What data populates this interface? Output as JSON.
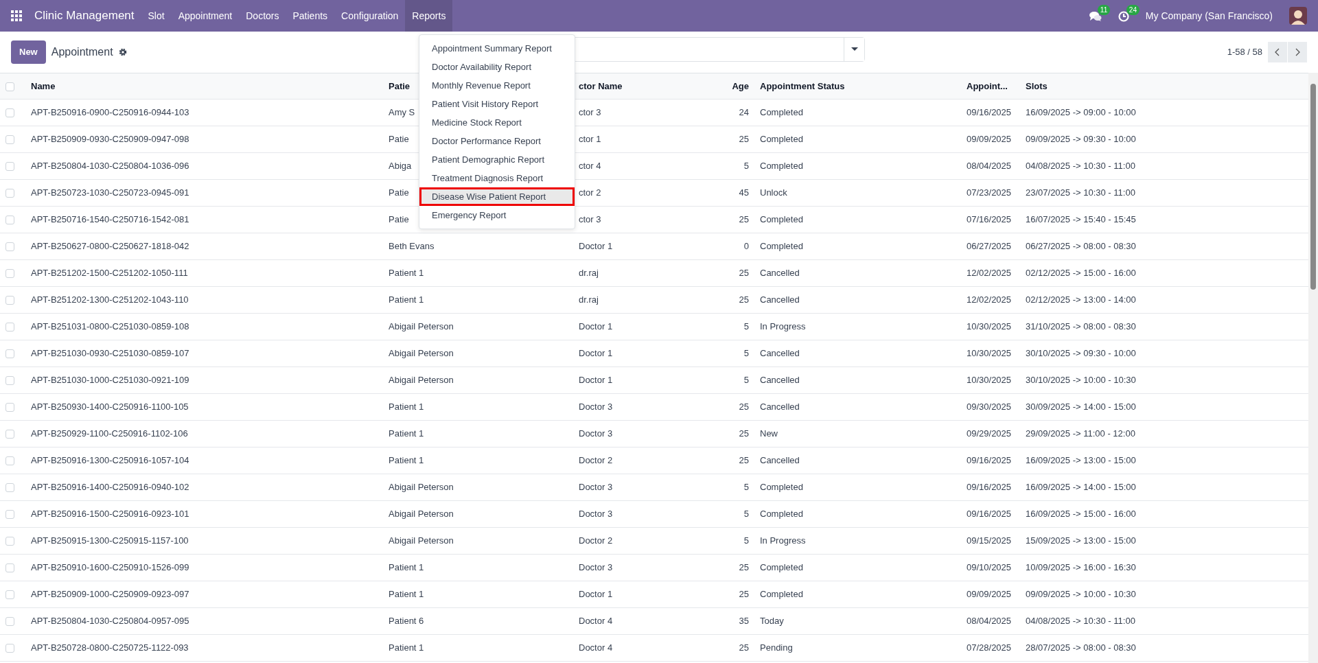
{
  "navbar": {
    "app_title": "Clinic Management",
    "menus": [
      {
        "label": "Slot",
        "open": false
      },
      {
        "label": "Appointment",
        "open": false
      },
      {
        "label": "Doctors",
        "open": false
      },
      {
        "label": "Patients",
        "open": false
      },
      {
        "label": "Configuration",
        "open": false
      },
      {
        "label": "Reports",
        "open": true
      }
    ],
    "messages_badge": "11",
    "activities_badge": "24",
    "company": "My Company (San Francisco)"
  },
  "control_panel": {
    "new_button": "New",
    "title": "Appointment",
    "pager": "1-58 / 58"
  },
  "reports_menu": {
    "items": [
      {
        "label": "Appointment Summary Report",
        "selected": false
      },
      {
        "label": "Doctor Availability Report",
        "selected": false
      },
      {
        "label": "Monthly Revenue Report",
        "selected": false
      },
      {
        "label": "Patient Visit History Report",
        "selected": false
      },
      {
        "label": "Medicine Stock Report",
        "selected": false
      },
      {
        "label": "Doctor Performance Report",
        "selected": false
      },
      {
        "label": "Patient Demographic Report",
        "selected": false
      },
      {
        "label": "Treatment Diagnosis Report",
        "selected": false
      },
      {
        "label": "Disease Wise Patient Report",
        "selected": true
      },
      {
        "label": "Emergency Report",
        "selected": false
      }
    ]
  },
  "table": {
    "select_all_checked": false,
    "columns": [
      "Name",
      "Patie",
      "ctor Name",
      "Age",
      "Appointment Status",
      "Appoint...",
      "Slots"
    ],
    "rows": [
      {
        "checked": false,
        "cells": [
          "APT-B250916-0900-C250916-0944-103",
          "Amy S",
          "ctor 3",
          "24",
          "Completed",
          "09/16/2025",
          "16/09/2025 -> 09:00 - 10:00"
        ]
      },
      {
        "checked": false,
        "cells": [
          "APT-B250909-0930-C250909-0947-098",
          "Patie",
          "ctor 1",
          "25",
          "Completed",
          "09/09/2025",
          "09/09/2025 -> 09:30 - 10:00"
        ]
      },
      {
        "checked": false,
        "cells": [
          "APT-B250804-1030-C250804-1036-096",
          "Abiga",
          "ctor 4",
          "5",
          "Completed",
          "08/04/2025",
          "04/08/2025 -> 10:30 - 11:00"
        ]
      },
      {
        "checked": false,
        "cells": [
          "APT-B250723-1030-C250723-0945-091",
          "Patie",
          "ctor 2",
          "45",
          "Unlock",
          "07/23/2025",
          "23/07/2025 -> 10:30 - 11:00"
        ]
      },
      {
        "checked": false,
        "cells": [
          "APT-B250716-1540-C250716-1542-081",
          "Patie",
          "ctor 3",
          "25",
          "Completed",
          "07/16/2025",
          "16/07/2025 -> 15:40 - 15:45"
        ]
      },
      {
        "checked": false,
        "cells": [
          "APT-B250627-0800-C250627-1818-042",
          "Beth Evans",
          "Doctor 1",
          "0",
          "Completed",
          "06/27/2025",
          "06/27/2025 -> 08:00 - 08:30"
        ]
      },
      {
        "checked": false,
        "cells": [
          "APT-B251202-1500-C251202-1050-111",
          "Patient 1",
          "dr.raj",
          "25",
          "Cancelled",
          "12/02/2025",
          "02/12/2025 -> 15:00 - 16:00"
        ]
      },
      {
        "checked": false,
        "cells": [
          "APT-B251202-1300-C251202-1043-110",
          "Patient 1",
          "dr.raj",
          "25",
          "Cancelled",
          "12/02/2025",
          "02/12/2025 -> 13:00 - 14:00"
        ]
      },
      {
        "checked": false,
        "cells": [
          "APT-B251031-0800-C251030-0859-108",
          "Abigail Peterson",
          "Doctor 1",
          "5",
          "In Progress",
          "10/30/2025",
          "31/10/2025 -> 08:00 - 08:30"
        ]
      },
      {
        "checked": false,
        "cells": [
          "APT-B251030-0930-C251030-0859-107",
          "Abigail Peterson",
          "Doctor 1",
          "5",
          "Cancelled",
          "10/30/2025",
          "30/10/2025 -> 09:30 - 10:00"
        ]
      },
      {
        "checked": false,
        "cells": [
          "APT-B251030-1000-C251030-0921-109",
          "Abigail Peterson",
          "Doctor 1",
          "5",
          "Cancelled",
          "10/30/2025",
          "30/10/2025 -> 10:00 - 10:30"
        ]
      },
      {
        "checked": false,
        "cells": [
          "APT-B250930-1400-C250916-1100-105",
          "Patient 1",
          "Doctor 3",
          "25",
          "Cancelled",
          "09/30/2025",
          "30/09/2025 -> 14:00 - 15:00"
        ]
      },
      {
        "checked": false,
        "cells": [
          "APT-B250929-1100-C250916-1102-106",
          "Patient 1",
          "Doctor 3",
          "25",
          "New",
          "09/29/2025",
          "29/09/2025 -> 11:00 - 12:00"
        ]
      },
      {
        "checked": false,
        "cells": [
          "APT-B250916-1300-C250916-1057-104",
          "Patient 1",
          "Doctor 2",
          "25",
          "Cancelled",
          "09/16/2025",
          "16/09/2025 -> 13:00 - 15:00"
        ]
      },
      {
        "checked": false,
        "cells": [
          "APT-B250916-1400-C250916-0940-102",
          "Abigail Peterson",
          "Doctor 3",
          "5",
          "Completed",
          "09/16/2025",
          "16/09/2025 -> 14:00 - 15:00"
        ]
      },
      {
        "checked": false,
        "cells": [
          "APT-B250916-1500-C250916-0923-101",
          "Abigail Peterson",
          "Doctor 3",
          "5",
          "Completed",
          "09/16/2025",
          "16/09/2025 -> 15:00 - 16:00"
        ]
      },
      {
        "checked": false,
        "cells": [
          "APT-B250915-1300-C250915-1157-100",
          "Abigail Peterson",
          "Doctor 2",
          "5",
          "In Progress",
          "09/15/2025",
          "15/09/2025 -> 13:00 - 15:00"
        ]
      },
      {
        "checked": false,
        "cells": [
          "APT-B250910-1600-C250910-1526-099",
          "Patient 1",
          "Doctor 3",
          "25",
          "Completed",
          "09/10/2025",
          "10/09/2025 -> 16:00 - 16:30"
        ]
      },
      {
        "checked": false,
        "cells": [
          "APT-B250909-1000-C250909-0923-097",
          "Patient 1",
          "Doctor 1",
          "25",
          "Completed",
          "09/09/2025",
          "09/09/2025 -> 10:00 - 10:30"
        ]
      },
      {
        "checked": false,
        "cells": [
          "APT-B250804-1030-C250804-0957-095",
          "Patient 6",
          "Doctor 4",
          "35",
          "Today",
          "08/04/2025",
          "04/08/2025 -> 10:30 - 11:00"
        ]
      },
      {
        "checked": false,
        "cells": [
          "APT-B250728-0800-C250725-1122-093",
          "Patient 1",
          "Doctor 4",
          "25",
          "Pending",
          "07/28/2025",
          "28/07/2025 -> 08:00 - 08:30"
        ]
      }
    ]
  }
}
